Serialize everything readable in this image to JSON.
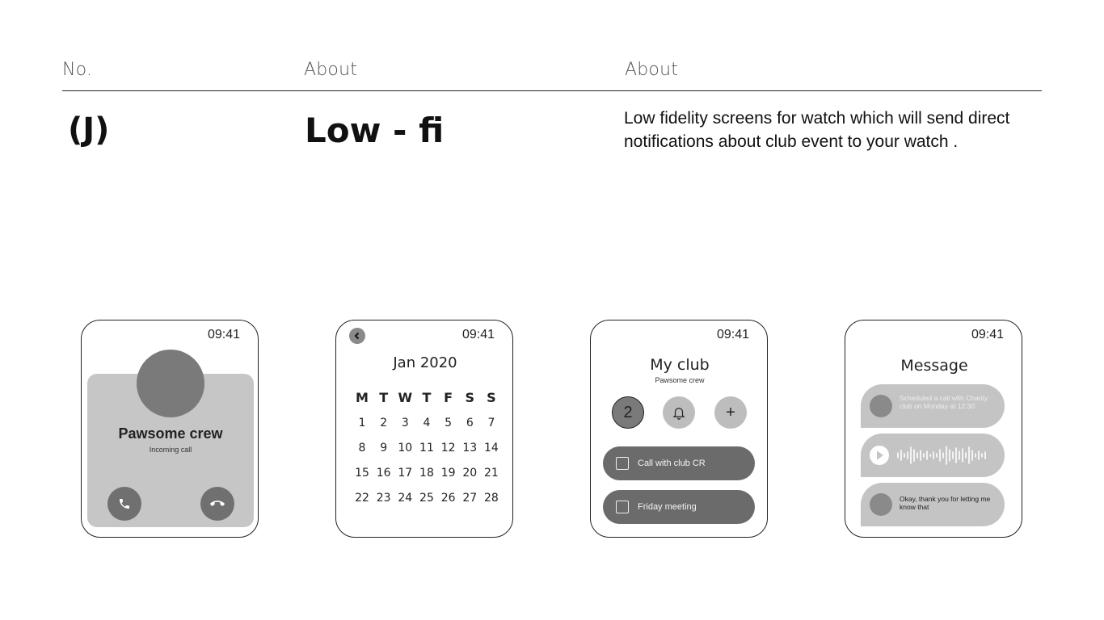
{
  "header": {
    "col1_label": "No.",
    "col2_label": "About",
    "col3_label": "About"
  },
  "section": {
    "number": "(J)",
    "title": "Low - fi",
    "description": "Low fidelity screens for watch which will send direct notifications about club event to your watch ."
  },
  "screens": {
    "call": {
      "time": "09:41",
      "caller": "Pawsome crew",
      "status": "Incoming call"
    },
    "calendar": {
      "time": "09:41",
      "month": "Jan 2020",
      "weekdays": [
        "M",
        "T",
        "W",
        "T",
        "F",
        "S",
        "S"
      ],
      "weeks": [
        [
          "1",
          "2",
          "3",
          "4",
          "5",
          "6",
          "7"
        ],
        [
          "8",
          "9",
          "10",
          "11",
          "12",
          "13",
          "14"
        ],
        [
          "15",
          "16",
          "17",
          "18",
          "19",
          "20",
          "21"
        ],
        [
          "22",
          "23",
          "24",
          "25",
          "26",
          "27",
          "28"
        ]
      ]
    },
    "club": {
      "time": "09:41",
      "title": "My club",
      "subtitle": "Pawsome crew",
      "badge_count": "2",
      "add_symbol": "+",
      "tasks": [
        "Call with club CR",
        "Friday meeting"
      ]
    },
    "message": {
      "time": "09:41",
      "title": "Message",
      "msg1": "Scheduled a call with Charity club on Monday at 12:30",
      "msg3": "Okay, thank you for letting me know  that"
    }
  },
  "colors": {
    "card_light": "#c6c6c6",
    "card_dark": "#6b6b6b",
    "avatar": "#7a7a7a"
  }
}
